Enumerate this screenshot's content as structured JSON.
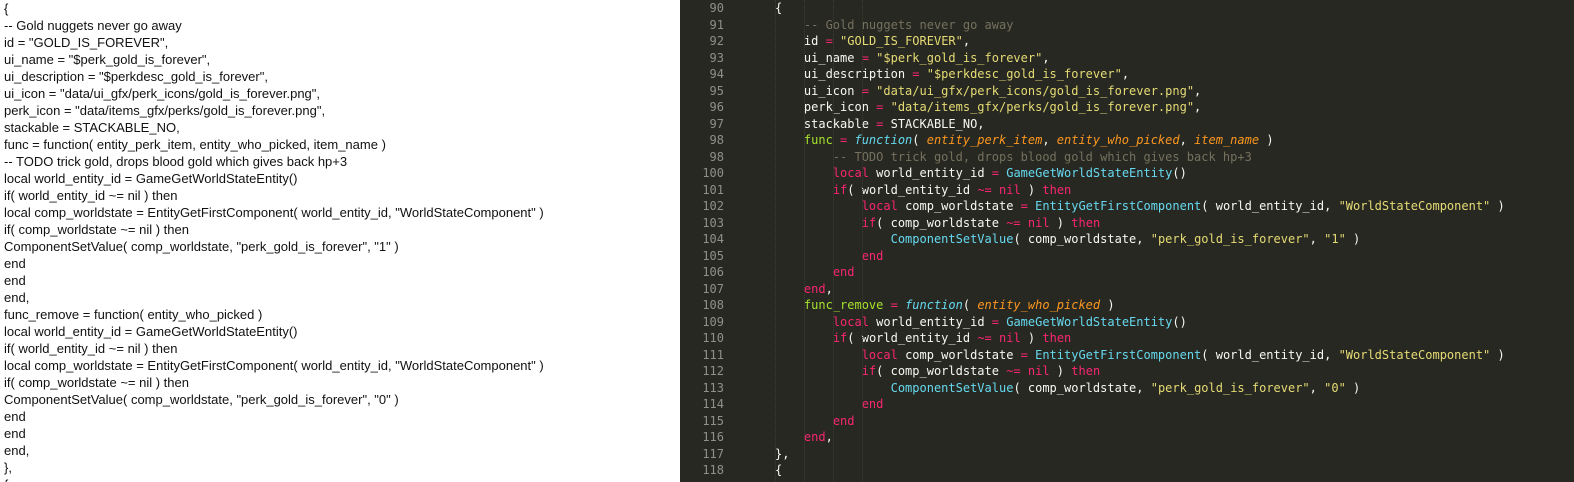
{
  "plain_view": {
    "lines": [
      "{",
      "-- Gold nuggets never go away",
      "id = \"GOLD_IS_FOREVER\",",
      "ui_name = \"$perk_gold_is_forever\",",
      "ui_description = \"$perkdesc_gold_is_forever\",",
      "ui_icon = \"data/ui_gfx/perk_icons/gold_is_forever.png\",",
      "perk_icon = \"data/items_gfx/perks/gold_is_forever.png\",",
      "stackable = STACKABLE_NO,",
      "func = function( entity_perk_item, entity_who_picked, item_name )",
      "-- TODO trick gold, drops blood gold which gives back hp+3",
      "local world_entity_id = GameGetWorldStateEntity()",
      "if( world_entity_id ~= nil ) then",
      "local comp_worldstate = EntityGetFirstComponent( world_entity_id, \"WorldStateComponent\" )",
      "if( comp_worldstate ~= nil ) then",
      "ComponentSetValue( comp_worldstate, \"perk_gold_is_forever\", \"1\" )",
      "end",
      "end",
      "end,",
      "func_remove = function( entity_who_picked )",
      "local world_entity_id = GameGetWorldStateEntity()",
      "if( world_entity_id ~= nil ) then",
      "local comp_worldstate = EntityGetFirstComponent( world_entity_id, \"WorldStateComponent\" )",
      "if( comp_worldstate ~= nil ) then",
      "ComponentSetValue( comp_worldstate, \"perk_gold_is_forever\", \"0\" )",
      "end",
      "end",
      "end,",
      "},",
      "{"
    ]
  },
  "editor_view": {
    "line_numbers": [
      "90",
      "91",
      "92",
      "93",
      "94",
      "95",
      "96",
      "97",
      "98",
      "98",
      "100",
      "101",
      "102",
      "103",
      "104",
      "105",
      "106",
      "107",
      "108",
      "109",
      "110",
      "111",
      "112",
      "113",
      "114",
      "115",
      "116",
      "117",
      "118"
    ],
    "lines": [
      [
        {
          "t": "{",
          "c": "plainTok"
        }
      ],
      [
        {
          "t": "-- Gold nuggets never go away",
          "c": "cmt"
        }
      ],
      [
        {
          "t": "id ",
          "c": "plainTok"
        },
        {
          "t": "= ",
          "c": "kw"
        },
        {
          "t": "\"GOLD_IS_FOREVER\"",
          "c": "str"
        },
        {
          "t": ",",
          "c": "plainTok"
        }
      ],
      [
        {
          "t": "ui_name ",
          "c": "plainTok"
        },
        {
          "t": "= ",
          "c": "kw"
        },
        {
          "t": "\"$perk_gold_is_forever\"",
          "c": "str"
        },
        {
          "t": ",",
          "c": "plainTok"
        }
      ],
      [
        {
          "t": "ui_description ",
          "c": "plainTok"
        },
        {
          "t": "= ",
          "c": "kw"
        },
        {
          "t": "\"$perkdesc_gold_is_forever\"",
          "c": "str"
        },
        {
          "t": ",",
          "c": "plainTok"
        }
      ],
      [
        {
          "t": "ui_icon ",
          "c": "plainTok"
        },
        {
          "t": "= ",
          "c": "kw"
        },
        {
          "t": "\"data/ui_gfx/perk_icons/gold_is_forever.png\"",
          "c": "str"
        },
        {
          "t": ",",
          "c": "plainTok"
        }
      ],
      [
        {
          "t": "perk_icon ",
          "c": "plainTok"
        },
        {
          "t": "= ",
          "c": "kw"
        },
        {
          "t": "\"data/items_gfx/perks/gold_is_forever.png\"",
          "c": "str"
        },
        {
          "t": ",",
          "c": "plainTok"
        }
      ],
      [
        {
          "t": "stackable ",
          "c": "plainTok"
        },
        {
          "t": "= ",
          "c": "kw"
        },
        {
          "t": "STACKABLE_NO,",
          "c": "plainTok"
        }
      ],
      [
        {
          "t": "func ",
          "c": "var"
        },
        {
          "t": "= ",
          "c": "kw"
        },
        {
          "t": "function",
          "c": "fnkw"
        },
        {
          "t": "( ",
          "c": "plainTok"
        },
        {
          "t": "entity_perk_item",
          "c": "param"
        },
        {
          "t": ", ",
          "c": "plainTok"
        },
        {
          "t": "entity_who_picked",
          "c": "param"
        },
        {
          "t": ", ",
          "c": "plainTok"
        },
        {
          "t": "item_name",
          "c": "param"
        },
        {
          "t": " )",
          "c": "plainTok"
        }
      ],
      [
        {
          "t": "    -- TODO trick gold, drops blood gold which gives back hp+3",
          "c": "cmt"
        }
      ],
      [
        {
          "t": "    ",
          "c": "plainTok"
        },
        {
          "t": "local ",
          "c": "kw"
        },
        {
          "t": "world_entity_id ",
          "c": "plainTok"
        },
        {
          "t": "= ",
          "c": "kw"
        },
        {
          "t": "GameGetWorldStateEntity",
          "c": "fn"
        },
        {
          "t": "()",
          "c": "plainTok"
        }
      ],
      [
        {
          "t": "    ",
          "c": "plainTok"
        },
        {
          "t": "if",
          "c": "kw"
        },
        {
          "t": "( world_entity_id ",
          "c": "plainTok"
        },
        {
          "t": "~= ",
          "c": "kw"
        },
        {
          "t": "nil",
          "c": "kw"
        },
        {
          "t": " ) ",
          "c": "plainTok"
        },
        {
          "t": "then",
          "c": "kw"
        }
      ],
      [
        {
          "t": "        ",
          "c": "plainTok"
        },
        {
          "t": "local ",
          "c": "kw"
        },
        {
          "t": "comp_worldstate ",
          "c": "plainTok"
        },
        {
          "t": "= ",
          "c": "kw"
        },
        {
          "t": "EntityGetFirstComponent",
          "c": "fn"
        },
        {
          "t": "( world_entity_id, ",
          "c": "plainTok"
        },
        {
          "t": "\"WorldStateComponent\"",
          "c": "str"
        },
        {
          "t": " )",
          "c": "plainTok"
        }
      ],
      [
        {
          "t": "        ",
          "c": "plainTok"
        },
        {
          "t": "if",
          "c": "kw"
        },
        {
          "t": "( comp_worldstate ",
          "c": "plainTok"
        },
        {
          "t": "~= ",
          "c": "kw"
        },
        {
          "t": "nil",
          "c": "kw"
        },
        {
          "t": " ) ",
          "c": "plainTok"
        },
        {
          "t": "then",
          "c": "kw"
        }
      ],
      [
        {
          "t": "            ",
          "c": "plainTok"
        },
        {
          "t": "ComponentSetValue",
          "c": "fn"
        },
        {
          "t": "( comp_worldstate, ",
          "c": "plainTok"
        },
        {
          "t": "\"perk_gold_is_forever\"",
          "c": "str"
        },
        {
          "t": ", ",
          "c": "plainTok"
        },
        {
          "t": "\"1\"",
          "c": "str"
        },
        {
          "t": " )",
          "c": "plainTok"
        }
      ],
      [
        {
          "t": "        ",
          "c": "plainTok"
        },
        {
          "t": "end",
          "c": "kw"
        }
      ],
      [
        {
          "t": "    ",
          "c": "plainTok"
        },
        {
          "t": "end",
          "c": "kw"
        }
      ],
      [
        {
          "t": "end",
          "c": "kw"
        },
        {
          "t": ",",
          "c": "plainTok"
        }
      ],
      [
        {
          "t": "func_remove ",
          "c": "var"
        },
        {
          "t": "= ",
          "c": "kw"
        },
        {
          "t": "function",
          "c": "fnkw"
        },
        {
          "t": "( ",
          "c": "plainTok"
        },
        {
          "t": "entity_who_picked",
          "c": "param"
        },
        {
          "t": " )",
          "c": "plainTok"
        }
      ],
      [
        {
          "t": "    ",
          "c": "plainTok"
        },
        {
          "t": "local ",
          "c": "kw"
        },
        {
          "t": "world_entity_id ",
          "c": "plainTok"
        },
        {
          "t": "= ",
          "c": "kw"
        },
        {
          "t": "GameGetWorldStateEntity",
          "c": "fn"
        },
        {
          "t": "()",
          "c": "plainTok"
        }
      ],
      [
        {
          "t": "    ",
          "c": "plainTok"
        },
        {
          "t": "if",
          "c": "kw"
        },
        {
          "t": "( world_entity_id ",
          "c": "plainTok"
        },
        {
          "t": "~= ",
          "c": "kw"
        },
        {
          "t": "nil",
          "c": "kw"
        },
        {
          "t": " ) ",
          "c": "plainTok"
        },
        {
          "t": "then",
          "c": "kw"
        }
      ],
      [
        {
          "t": "        ",
          "c": "plainTok"
        },
        {
          "t": "local ",
          "c": "kw"
        },
        {
          "t": "comp_worldstate ",
          "c": "plainTok"
        },
        {
          "t": "= ",
          "c": "kw"
        },
        {
          "t": "EntityGetFirstComponent",
          "c": "fn"
        },
        {
          "t": "( world_entity_id, ",
          "c": "plainTok"
        },
        {
          "t": "\"WorldStateComponent\"",
          "c": "str"
        },
        {
          "t": " )",
          "c": "plainTok"
        }
      ],
      [
        {
          "t": "        ",
          "c": "plainTok"
        },
        {
          "t": "if",
          "c": "kw"
        },
        {
          "t": "( comp_worldstate ",
          "c": "plainTok"
        },
        {
          "t": "~= ",
          "c": "kw"
        },
        {
          "t": "nil",
          "c": "kw"
        },
        {
          "t": " ) ",
          "c": "plainTok"
        },
        {
          "t": "then",
          "c": "kw"
        }
      ],
      [
        {
          "t": "            ",
          "c": "plainTok"
        },
        {
          "t": "ComponentSetValue",
          "c": "fn"
        },
        {
          "t": "( comp_worldstate, ",
          "c": "plainTok"
        },
        {
          "t": "\"perk_gold_is_forever\"",
          "c": "str"
        },
        {
          "t": ", ",
          "c": "plainTok"
        },
        {
          "t": "\"0\"",
          "c": "str"
        },
        {
          "t": " )",
          "c": "plainTok"
        }
      ],
      [
        {
          "t": "        ",
          "c": "plainTok"
        },
        {
          "t": "end",
          "c": "kw"
        }
      ],
      [
        {
          "t": "    ",
          "c": "plainTok"
        },
        {
          "t": "end",
          "c": "kw"
        }
      ],
      [
        {
          "t": "end",
          "c": "kw"
        },
        {
          "t": ",",
          "c": "plainTok"
        }
      ],
      [
        {
          "t": "},",
          "c": "plainTok"
        }
      ],
      [
        {
          "t": "{",
          "c": "plainTok"
        }
      ]
    ],
    "line_indent": [
      0,
      1,
      1,
      1,
      1,
      1,
      1,
      1,
      1,
      1,
      1,
      1,
      1,
      1,
      1,
      1,
      1,
      1,
      1,
      1,
      1,
      1,
      1,
      1,
      1,
      1,
      1,
      0,
      0
    ]
  }
}
